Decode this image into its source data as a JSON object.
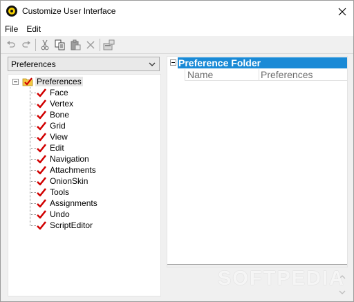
{
  "window": {
    "title": "Customize User Interface"
  },
  "menu": {
    "items": [
      "File",
      "Edit"
    ]
  },
  "toolbar": {
    "buttons": [
      "undo-icon",
      "redo-icon",
      "cut-icon",
      "copy-icon",
      "paste-icon",
      "delete-icon",
      "properties-icon"
    ]
  },
  "dropdown": {
    "value": "Preferences"
  },
  "tree": {
    "root_label": "Preferences",
    "items": [
      "Face",
      "Vertex",
      "Bone",
      "Grid",
      "View",
      "Edit",
      "Navigation",
      "Attachments",
      "OnionSkin",
      "Tools",
      "Assignments",
      "Undo",
      "ScriptEditor"
    ]
  },
  "detail": {
    "folder_title": "Preference Folder",
    "columns": [
      "Name",
      "Preferences"
    ]
  },
  "watermark": "SOFTPEDIA",
  "colors": {
    "selection_blue": "#1a8ad6",
    "check_red": "#d10000",
    "folder_yellow": "#f4c842"
  }
}
